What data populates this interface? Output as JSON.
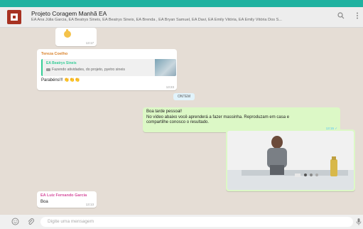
{
  "header": {
    "title": "Projeto Coragem Manhã EA",
    "members": "EA Ana Júlia Garcia, EA Beatrys Sineis, EA Beatrys Sineis, EA Brenda , EA Bryan Samuel, EA Davi, EA Emily Vitória, EA Emily Vitória Dos S..."
  },
  "messages": {
    "m1": {
      "time": "13:17"
    },
    "m2": {
      "sender": "Tereza Coelho",
      "quote_sender": "EA Beatrys Sineis",
      "quote_text": "Fazendo atividades, do projeto, pyetro sineis",
      "text": "Parabéns!!! 👏👏👏",
      "time": "13:23"
    },
    "date_chip": "ONTEM",
    "m3": {
      "line1": "Boa tarde pessoal!",
      "line2": "No vídeo abaixo você aprenderá a fazer massinha. Reproduzam em casa e",
      "line3": "compartilhe conosco o resultado.",
      "time": "13:15 ✓"
    },
    "m4": {
      "sender": "EA Luiz Fernando Garcia",
      "text": "Boa",
      "time": "13:13"
    }
  },
  "footer": {
    "placeholder": "Digite uma mensagem"
  },
  "icons": [
    "search-icon",
    "menu-icon",
    "emoji-icon",
    "attach-icon",
    "mic-icon",
    "clap-emoji-icon",
    "image-icon"
  ]
}
